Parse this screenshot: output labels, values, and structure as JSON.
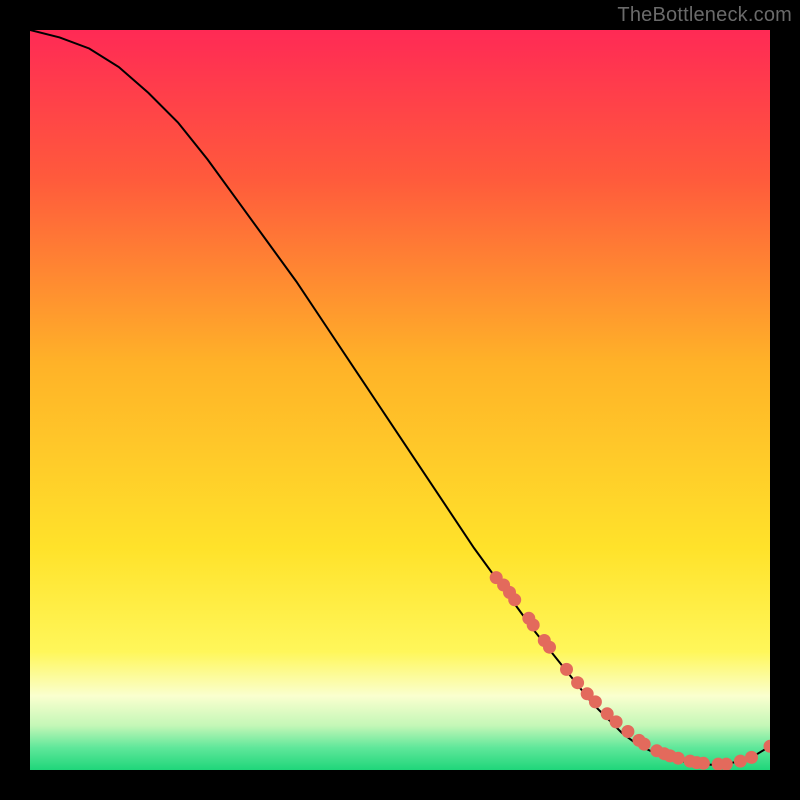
{
  "watermark": "TheBottleneck.com",
  "colors": {
    "background": "#000000",
    "watermark_text": "#6a6a6a",
    "curve": "#000000",
    "marker": "#e36a5c",
    "gradient_stops": [
      {
        "offset": 0.0,
        "color": "#ff2a55"
      },
      {
        "offset": 0.2,
        "color": "#ff5a3c"
      },
      {
        "offset": 0.45,
        "color": "#ffb228"
      },
      {
        "offset": 0.7,
        "color": "#ffe22a"
      },
      {
        "offset": 0.84,
        "color": "#fff75a"
      },
      {
        "offset": 0.9,
        "color": "#faffcf"
      },
      {
        "offset": 0.94,
        "color": "#c4f7b7"
      },
      {
        "offset": 0.97,
        "color": "#5fe79a"
      },
      {
        "offset": 1.0,
        "color": "#1fd67a"
      }
    ]
  },
  "chart_data": {
    "type": "line",
    "title": "",
    "xlabel": "",
    "ylabel": "",
    "xlim": [
      0,
      100
    ],
    "ylim": [
      0,
      100
    ],
    "grid": false,
    "legend": false,
    "series": [
      {
        "name": "bottleneck-curve",
        "x": [
          0,
          4,
          8,
          12,
          16,
          20,
          24,
          28,
          32,
          36,
          40,
          44,
          48,
          52,
          56,
          60,
          64,
          68,
          72,
          76,
          80,
          82,
          84,
          86,
          88,
          90,
          92,
          94,
          96,
          98,
          100
        ],
        "y": [
          100,
          99,
          97.5,
          95,
          91.5,
          87.5,
          82.5,
          77,
          71.5,
          66,
          60,
          54,
          48,
          42,
          36,
          30,
          24.5,
          19,
          14,
          9,
          5,
          3.5,
          2.5,
          1.8,
          1.2,
          0.9,
          0.7,
          0.8,
          1.2,
          2,
          3.2
        ]
      }
    ],
    "markers": {
      "name": "highlight-points",
      "x": [
        63,
        64,
        64.8,
        65.5,
        67.4,
        68,
        69.5,
        70.2,
        72.5,
        74,
        75.3,
        76.4,
        78,
        79.2,
        80.8,
        82.3,
        83,
        84.7,
        85.7,
        86.5,
        87.6,
        89.2,
        90.1,
        91,
        93,
        94.1,
        96,
        97.5,
        100
      ],
      "y": [
        26,
        25,
        24,
        23,
        20.5,
        19.6,
        17.5,
        16.6,
        13.6,
        11.8,
        10.3,
        9.2,
        7.6,
        6.5,
        5.2,
        4,
        3.5,
        2.6,
        2.2,
        1.9,
        1.6,
        1.2,
        1,
        0.9,
        0.8,
        0.8,
        1.2,
        1.7,
        3.2
      ]
    }
  }
}
